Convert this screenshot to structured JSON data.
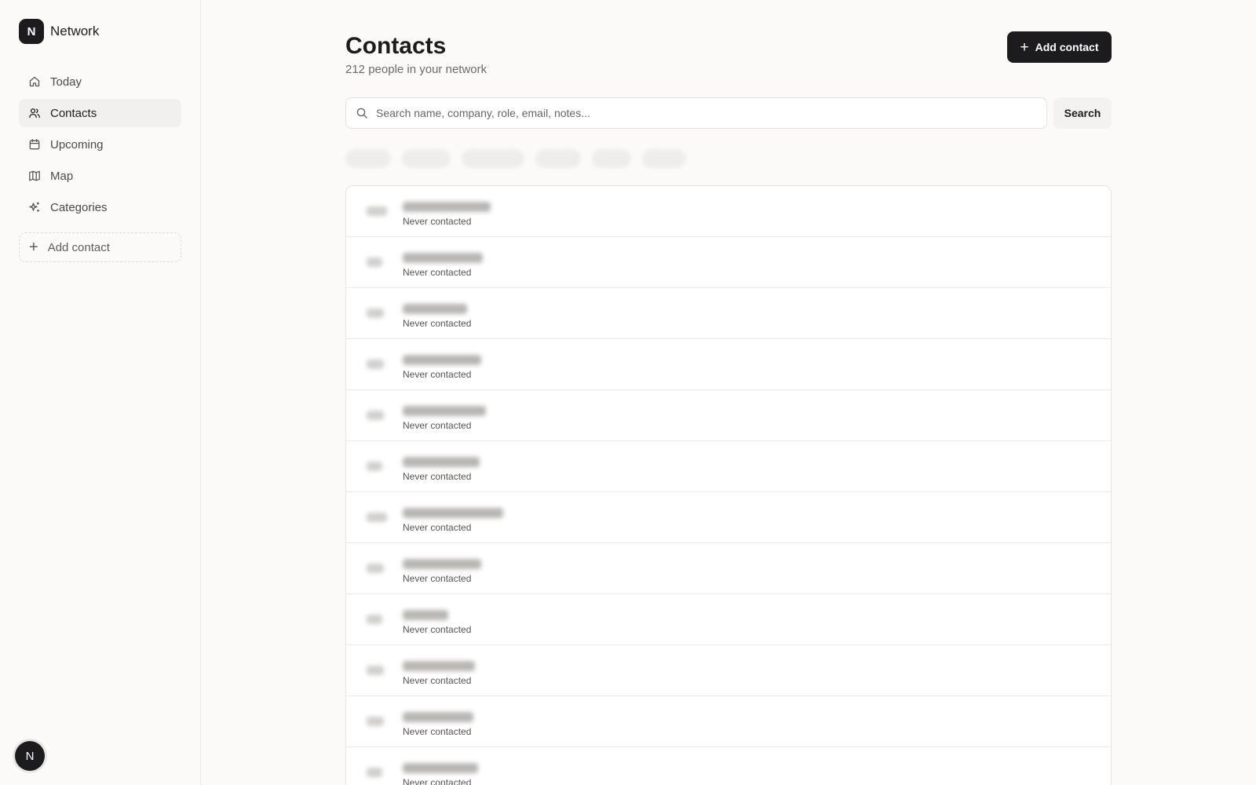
{
  "app": {
    "logo_letter": "N",
    "name": "Network"
  },
  "sidebar": {
    "items": [
      {
        "label": "Today",
        "icon": "home-icon",
        "active": false
      },
      {
        "label": "Contacts",
        "icon": "users-icon",
        "active": true
      },
      {
        "label": "Upcoming",
        "icon": "calendar-icon",
        "active": false
      },
      {
        "label": "Map",
        "icon": "map-icon",
        "active": false
      },
      {
        "label": "Categories",
        "icon": "sparkles-icon",
        "active": false
      }
    ],
    "add_contact_label": "Add contact",
    "user_initial": "N"
  },
  "header": {
    "title": "Contacts",
    "subtitle": "212 people in your network",
    "add_button_label": "Add contact"
  },
  "search": {
    "placeholder": "Search name, company, role, email, notes...",
    "value": "",
    "button_label": "Search"
  },
  "contacts": [
    {
      "status": "Never contacted"
    },
    {
      "status": "Never contacted"
    },
    {
      "status": "Never contacted"
    },
    {
      "status": "Never contacted"
    },
    {
      "status": "Never contacted"
    },
    {
      "status": "Never contacted"
    },
    {
      "status": "Never contacted"
    },
    {
      "status": "Never contacted"
    },
    {
      "status": "Never contacted"
    },
    {
      "status": "Never contacted"
    },
    {
      "status": "Never contacted"
    },
    {
      "status": "Never contacted"
    }
  ],
  "colors": {
    "accent": "#1c1c1e",
    "background": "#fbfaf9",
    "border": "#e6e4e1"
  }
}
